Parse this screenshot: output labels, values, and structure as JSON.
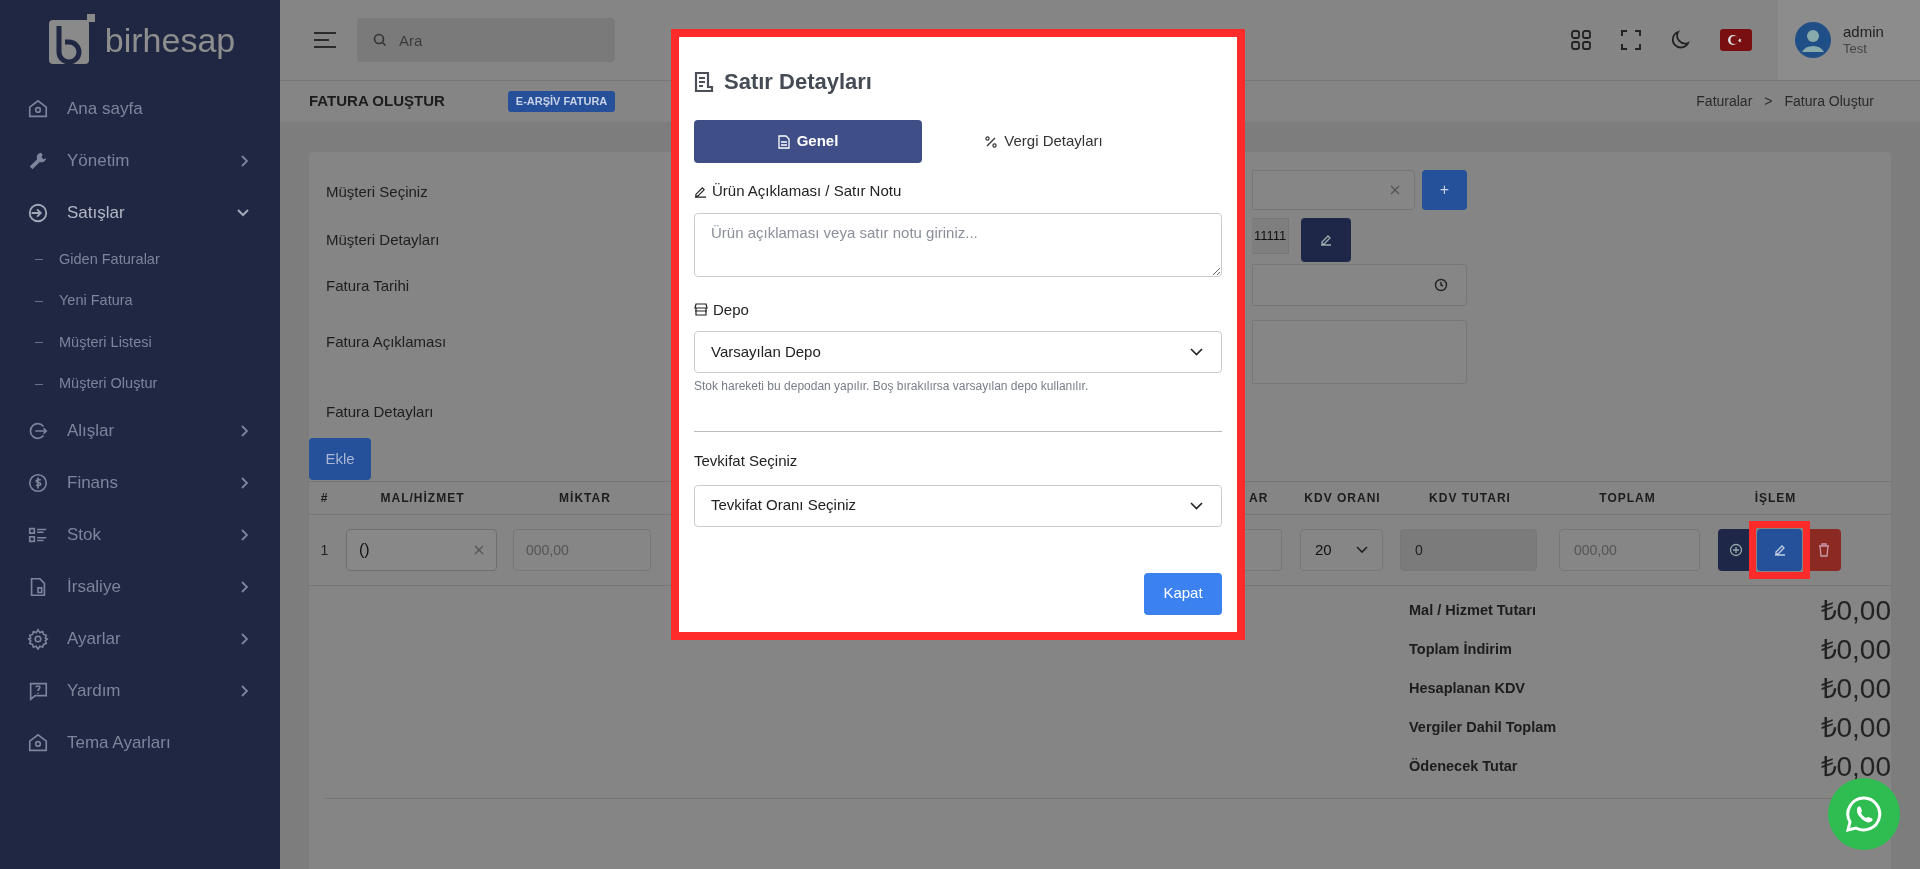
{
  "brand": {
    "name": "birhesap"
  },
  "sidebar": {
    "items": [
      {
        "label": "Ana sayfa",
        "kind": "link",
        "selected": false
      },
      {
        "label": "Yönetim",
        "kind": "group",
        "expanded": false,
        "selected": false
      },
      {
        "label": "Satışlar",
        "kind": "group",
        "expanded": true,
        "selected": true,
        "children": [
          {
            "label": "Giden Faturalar"
          },
          {
            "label": "Yeni Fatura"
          },
          {
            "label": "Müşteri Listesi"
          },
          {
            "label": "Müşteri Oluştur"
          }
        ]
      },
      {
        "label": "Alışlar",
        "kind": "group",
        "expanded": false,
        "selected": false
      },
      {
        "label": "Finans",
        "kind": "group",
        "expanded": false,
        "selected": false
      },
      {
        "label": "Stok",
        "kind": "group",
        "expanded": false,
        "selected": false
      },
      {
        "label": "İrsaliye",
        "kind": "group",
        "expanded": false,
        "selected": false
      },
      {
        "label": "Ayarlar",
        "kind": "group",
        "expanded": false,
        "selected": false
      },
      {
        "label": "Yardım",
        "kind": "group",
        "expanded": false,
        "selected": false
      },
      {
        "label": "Tema Ayarları",
        "kind": "link",
        "selected": false
      }
    ]
  },
  "topbar": {
    "search": {
      "placeholder": "Ara"
    },
    "user": {
      "name": "admin",
      "role": "Test"
    }
  },
  "page_header": {
    "title": "FATURA OLUŞTUR",
    "badge": "E-ARŞİV FATURA",
    "breadcrumb": [
      "Faturalar",
      "Fatura Oluştur"
    ],
    "separator": ">"
  },
  "form": {
    "rows": [
      {
        "label": "Müşteri Seçiniz",
        "kind": "select"
      },
      {
        "label": "Müşteri Detayları",
        "kind": "details",
        "value": "11111"
      },
      {
        "label": "Fatura Tarihi",
        "kind": "date"
      },
      {
        "label": "Fatura Açıklaması",
        "kind": "textarea"
      },
      {
        "label": "Fatura Detayları",
        "kind": "heading"
      }
    ],
    "add_button": "+"
  },
  "add_row_button": "Ekle",
  "table": {
    "columns": [
      "#",
      "MAL/HİZMET",
      "MİKTAR",
      "AR",
      "KDV ORANI",
      "KDV TUTARI",
      "TOPLAM",
      "İŞLEM"
    ],
    "rows": [
      {
        "index": "1",
        "product": "()",
        "quantity_placeholder": "000,00",
        "vat_rate": "20",
        "vat_amount": "0",
        "total_placeholder": "000,00",
        "actions": [
          {
            "kind": "add",
            "outlined": false
          },
          {
            "kind": "edit",
            "outlined": true
          },
          {
            "kind": "delete",
            "outlined": false
          }
        ]
      }
    ]
  },
  "totals": [
    {
      "label": "Mal / Hizmet Tutarı",
      "value": "₺0,00"
    },
    {
      "label": "Toplam İndirim",
      "value": "₺0,00"
    },
    {
      "label": "Hesaplanan KDV",
      "value": "₺0,00"
    },
    {
      "label": "Vergiler Dahil Toplam",
      "value": "₺0,00"
    },
    {
      "label": "Ödenecek Tutar",
      "value": "₺0,00"
    }
  ],
  "modal": {
    "title": "Satır Detayları",
    "outlined": true,
    "tabs": [
      {
        "label": "Genel",
        "selected": true
      },
      {
        "label": "Vergi Detayları",
        "selected": false
      }
    ],
    "note_label": "Ürün Açıklaması / Satır Notu",
    "note_placeholder": "Ürün açıklaması veya satır notu giriniz...",
    "depot_label": "Depo",
    "depot_value": "Varsayılan Depo",
    "depot_help": "Stok hareketi bu depodan yapılır. Boş bırakılırsa varsayılan depo kullanılır.",
    "withholding_label": "Tevkifat Seçiniz",
    "withholding_value": "Tevkifat Oranı Seçiniz",
    "close_button": "Kapat"
  }
}
